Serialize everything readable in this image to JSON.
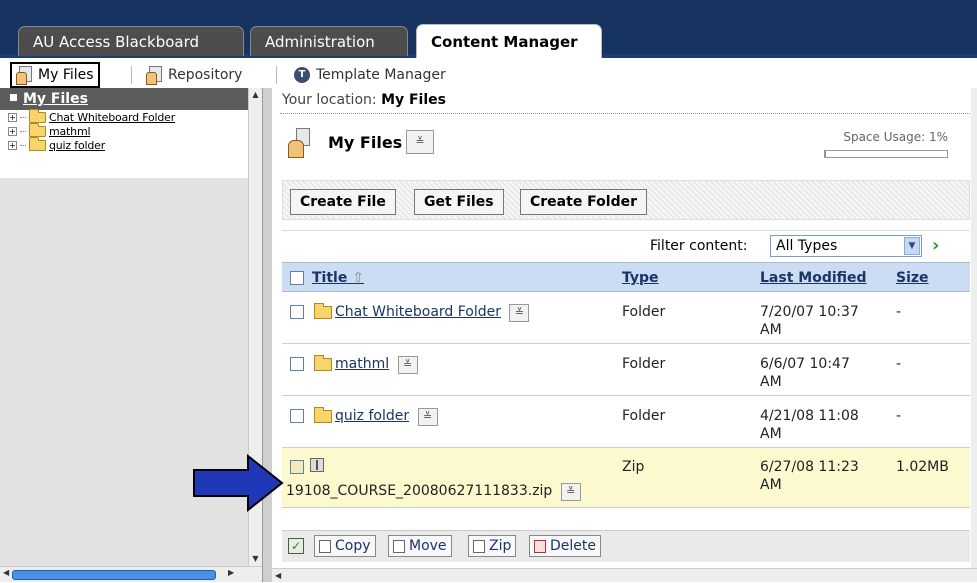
{
  "tabs": [
    "AU Access Blackboard",
    "Administration",
    "Content Manager"
  ],
  "subnav": {
    "my_files": "My Files",
    "repository": "Repository",
    "template_manager": "Template Manager"
  },
  "sidebar": {
    "header": "My Files",
    "tree": [
      "Chat Whiteboard Folder",
      "mathml",
      "quiz folder"
    ]
  },
  "location": {
    "label": "Your location:",
    "value": "My Files"
  },
  "folder_title": "My Files",
  "space_usage": {
    "label": "Space Usage: 1%",
    "percent": 1
  },
  "actions": [
    "Create File",
    "Get Files",
    "Create Folder"
  ],
  "filter": {
    "label": "Filter content:",
    "value": "All Types"
  },
  "table": {
    "headers": {
      "title": "Title",
      "type": "Type",
      "modified": "Last Modified",
      "size": "Size"
    },
    "rows": [
      {
        "title": "Chat Whiteboard Folder",
        "type": "Folder",
        "modified_1": "7/20/07 10:37",
        "modified_2": "AM",
        "size": "-"
      },
      {
        "title": "mathml",
        "type": "Folder",
        "modified_1": "6/6/07 10:47",
        "modified_2": "AM",
        "size": "-"
      },
      {
        "title": "quiz folder",
        "type": "Folder",
        "modified_1": "4/21/08 11:08",
        "modified_2": "AM",
        "size": "-"
      },
      {
        "title": "19108_COURSE_20080627111833.zip",
        "type": "Zip",
        "modified_1": "6/27/08 11:23",
        "modified_2": "AM",
        "size": "1.02MB"
      }
    ]
  },
  "bottom_actions": {
    "copy": "Copy",
    "move": "Move",
    "zip": "Zip",
    "delete": "Delete"
  },
  "colors": {
    "topbar": "#17335f",
    "header_row": "#ccdcf2",
    "highlight_row": "#fcf9cf",
    "arrow": "#1f38b8"
  }
}
